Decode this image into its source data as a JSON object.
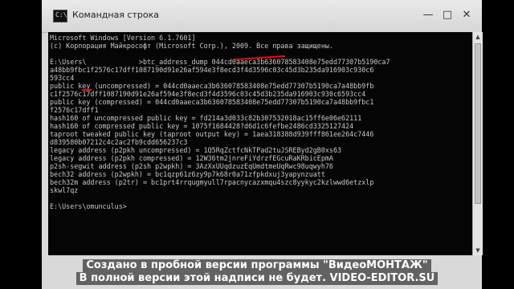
{
  "window": {
    "title": "Командная строка"
  },
  "console": {
    "lines": [
      "Microsoft Windows [Version 6.1.7601]",
      "(с) Корпорация Майкрософт (Microsoft Corp.), 2009. Все права защищены.",
      "",
      "E:\\Users\\             >btc_address_dump 044cd0aaeca3b636078583408e75edd77307b5190ca7",
      "a48bb9fbc1f2576c17dff1087190d91e26af594e3f8ecd3f4d3596c03c45d3b235da916903c930c6",
      "593cc4",
      "public key (uncompressed) = 044cd0aaeca3b636078583408e75edd77307b5190ca7a48bb9fb",
      "c1f2576c17dff1087190d91e26af594e3f8ecd3f4d3596c03c45d3b235da916903c930c6593cc4",
      "public key (compressed) = 044cd0aaeca3b636078583408e75edd77307b5190ca7a48bb9fbc1",
      "f2576c17dff1",
      "hash160 of uncompressed public key = fd214a3d033c82b307532018ac15ff6e06e62111",
      "hash160 of compressed public key = 1075f1684428?d6d1c6fefbe2486cd3325127424",
      "taproot tweaked public key (taproot output key) = 1aea318388d939fff861ee264c7446",
      "d839580b07212c4c2ac2fb9cdd656237c3",
      "legacy address (p2pkh uncompressed) = 1Q5RqZctfcNkTPad2tuJSREByd2gB0xs63",
      "legacy address (p2pkh compressed) = 12W36tm2jnreFiYdrzfEGcuRaKRbicEpmA",
      "p2sh-segwit address (p2sh p2wpkh) = 3AzXxUUqdzuzEqUmdtmeUqRwc98uqwyh76",
      "bech32 address (p2wpkh) = bc1qzp61z6zy9p7k68r0a71zfpkdxuj3yapynzuatt",
      "bech32m address (p2tr) = bc1prt4rrqugmyull7rpacnycazxmqu4szc8yykyc2kzlwwd6etzxlp",
      "skwl7qz",
      "",
      "E:\\Users\\omunculus>"
    ]
  },
  "watermark": {
    "line1": "Создано в пробной версии программы \"ВидеоМОНТАЖ\"",
    "line2": "В полной версии этой надписи не будет. VIDEO-EDITOR.SU"
  },
  "icons": {
    "app": "cmd-icon",
    "minimize": "minimize-icon",
    "maximize": "maximize-icon",
    "close": "close-icon"
  }
}
